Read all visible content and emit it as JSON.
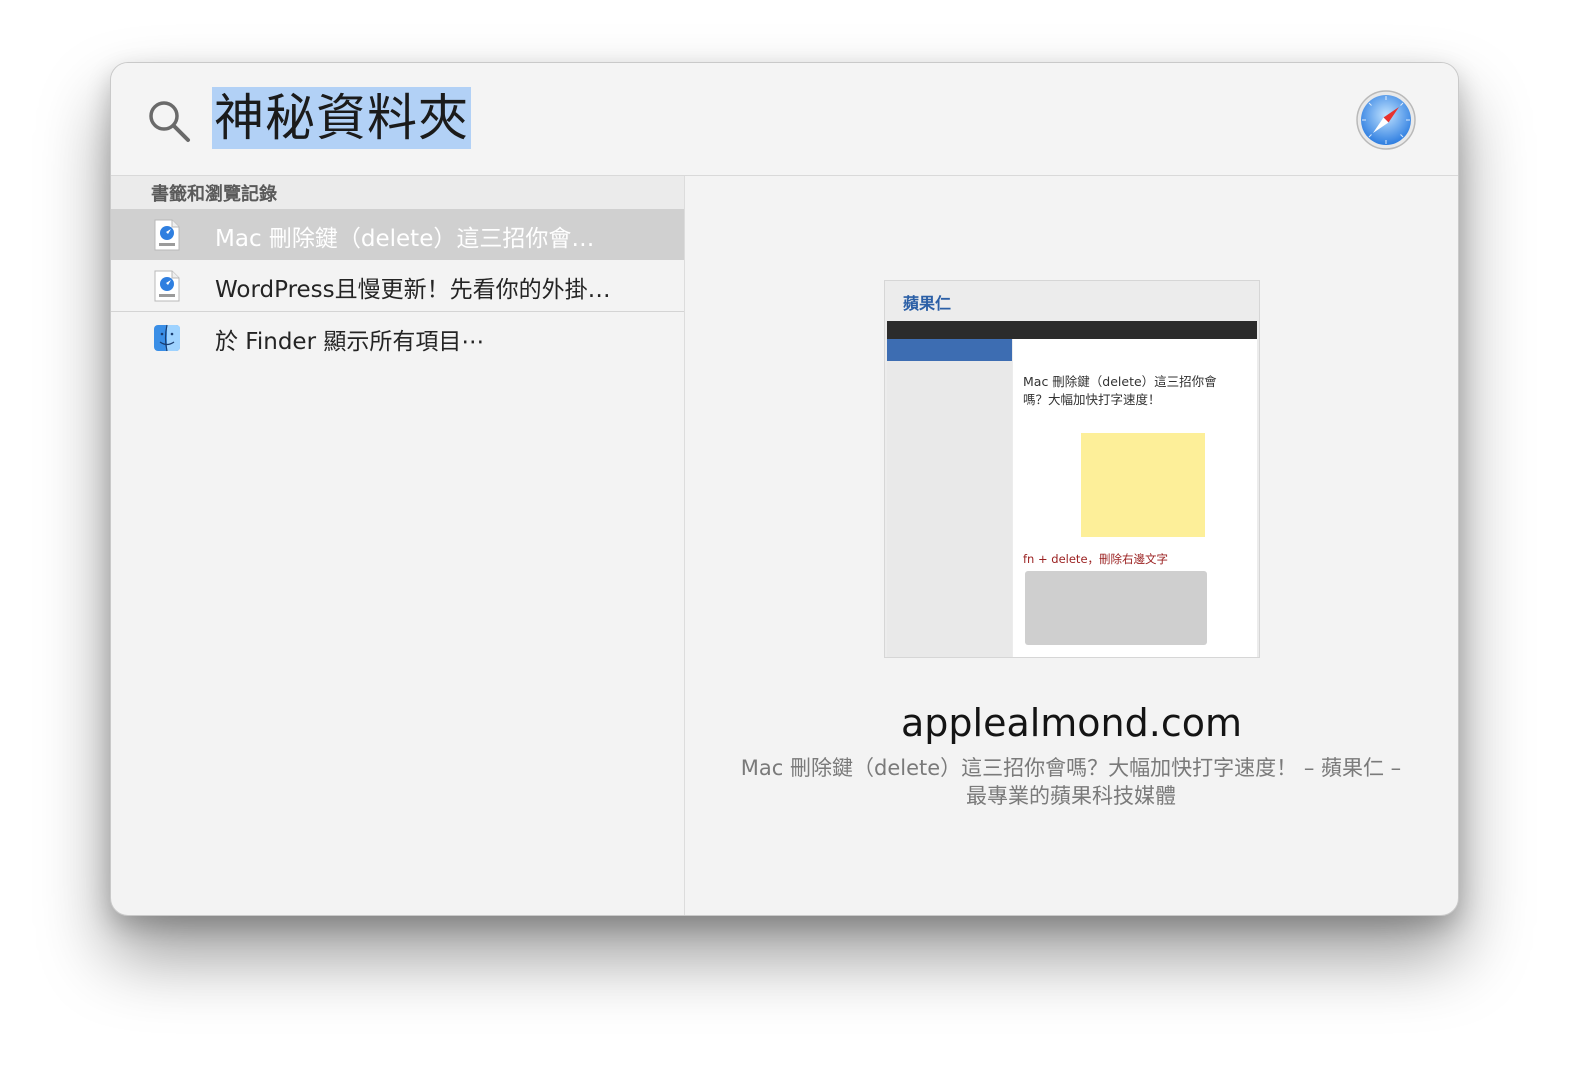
{
  "search": {
    "query": "神秘資料夾"
  },
  "results": {
    "section_title": "書籤和瀏覽記錄",
    "items": [
      {
        "label": "Mac 刪除鍵（delete）這三招你會…",
        "icon": "webloc-file-icon",
        "selected": true
      },
      {
        "label": "WordPress且慢更新！先看你的外掛…",
        "icon": "webloc-file-icon",
        "selected": false
      },
      {
        "label": "於 Finder 顯示所有項目⋯",
        "icon": "finder-icon",
        "selected": false
      }
    ]
  },
  "preview": {
    "site_logo": "蘋果仁",
    "article_title": "Mac 刪除鍵（delete）這三招你會嗎？大幅加快打字速度！",
    "article_subheading": "fn + delete，刪除右邊文字",
    "domain": "applealmond.com",
    "description": "Mac 刪除鍵（delete）這三招你會嗎？大幅加快打字速度！ – 蘋果仁 – 最專業的蘋果科技媒體"
  },
  "colors": {
    "selection_highlight": "#b2d1f6",
    "selected_row": "#d0d0d0",
    "window_bg": "#f3f3f3"
  }
}
